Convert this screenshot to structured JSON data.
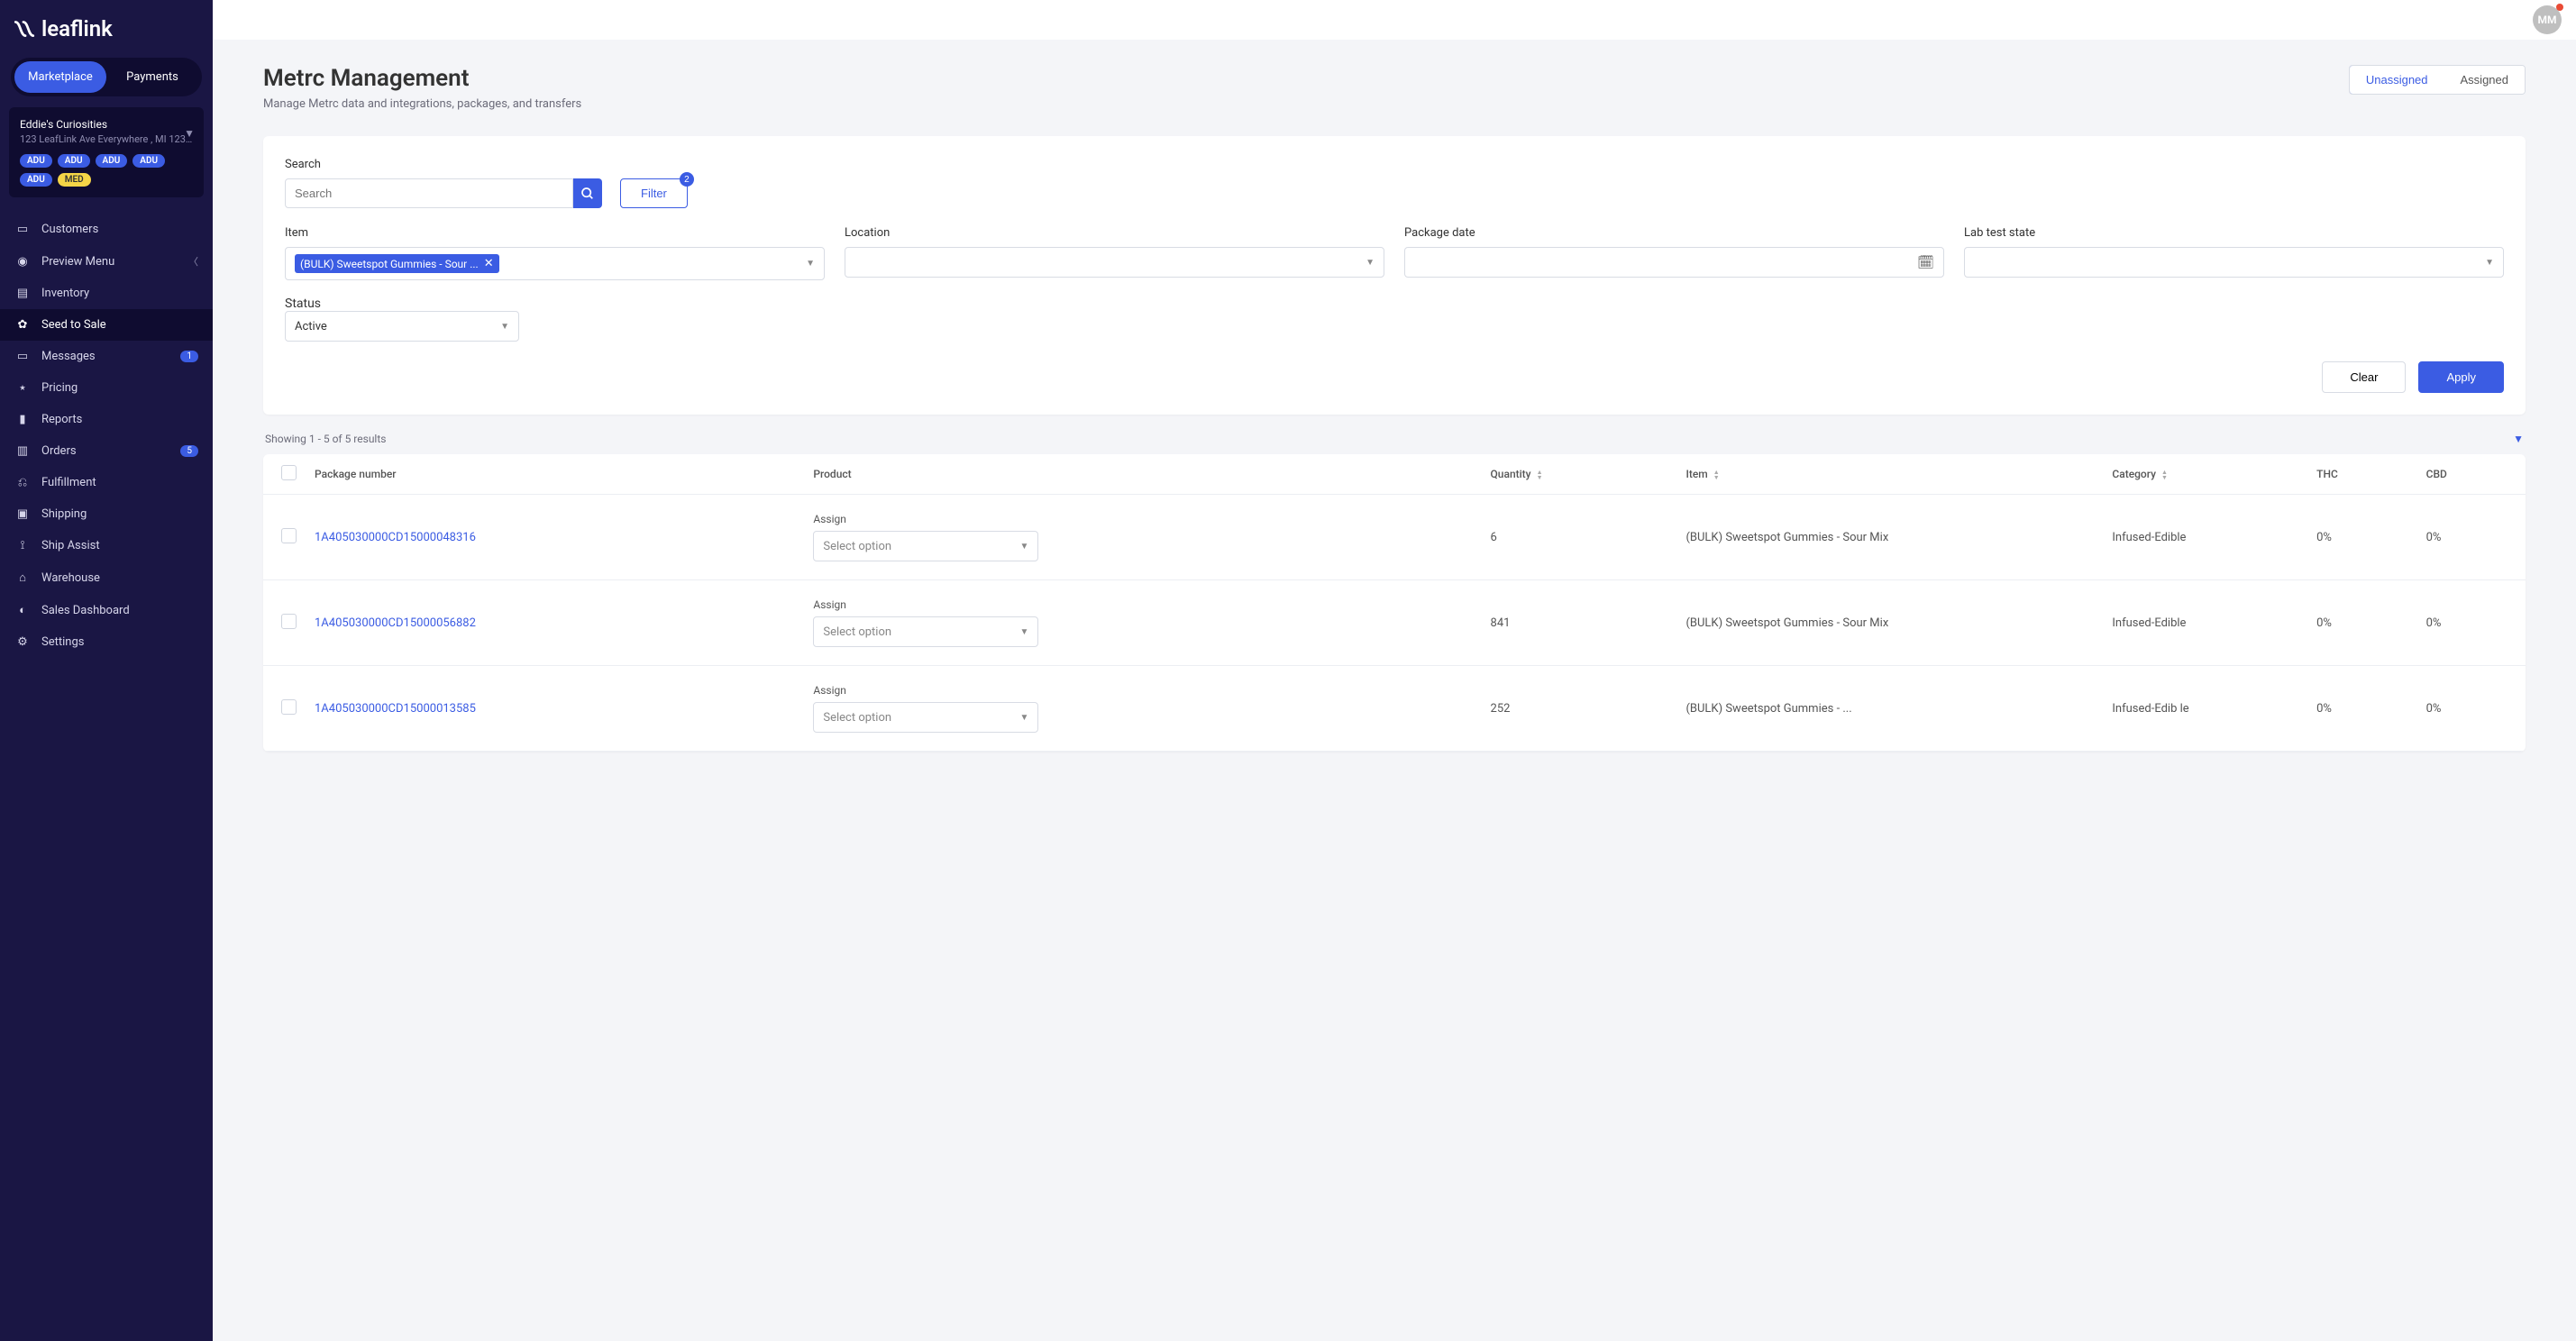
{
  "brand": "leaflink",
  "topTabs": {
    "marketplace": "Marketplace",
    "payments": "Payments"
  },
  "company": {
    "name": "Eddie's Curiosities",
    "address": "123 LeafLink Ave Everywhere , MI 123...",
    "badges": [
      "ADU",
      "ADU",
      "ADU",
      "ADU",
      "ADU",
      "MED"
    ]
  },
  "nav": [
    {
      "id": "customers",
      "label": "Customers"
    },
    {
      "id": "preview",
      "label": "Preview Menu",
      "chevron": true
    },
    {
      "id": "inventory",
      "label": "Inventory"
    },
    {
      "id": "seed-to-sale",
      "label": "Seed to Sale",
      "active": true
    },
    {
      "id": "messages",
      "label": "Messages",
      "count": "1"
    },
    {
      "id": "pricing",
      "label": "Pricing"
    },
    {
      "id": "reports",
      "label": "Reports"
    },
    {
      "id": "orders",
      "label": "Orders",
      "count": "5"
    },
    {
      "id": "fulfillment",
      "label": "Fulfillment"
    },
    {
      "id": "shipping",
      "label": "Shipping"
    },
    {
      "id": "ship-assist",
      "label": "Ship Assist"
    },
    {
      "id": "warehouse",
      "label": "Warehouse"
    },
    {
      "id": "sales-dashboard",
      "label": "Sales Dashboard"
    },
    {
      "id": "settings",
      "label": "Settings"
    }
  ],
  "avatar": "MM",
  "page": {
    "title": "Metrc Management",
    "subtitle": "Manage Metrc data and integrations, packages, and transfers",
    "tabs": {
      "unassigned": "Unassigned",
      "assigned": "Assigned"
    }
  },
  "filters": {
    "search_label": "Search",
    "search_placeholder": "Search",
    "filter_btn": "Filter",
    "filter_count": "2",
    "item_label": "Item",
    "item_chip": "(BULK) Sweetspot Gummies - Sour ...",
    "location_label": "Location",
    "package_date_label": "Package date",
    "lab_test_label": "Lab test state",
    "status_label": "Status",
    "status_value": "Active",
    "clear": "Clear",
    "apply": "Apply"
  },
  "results": {
    "meta": "Showing 1 - 5 of 5 results",
    "columns": {
      "package": "Package number",
      "product": "Product",
      "quantity": "Quantity",
      "item": "Item",
      "category": "Category",
      "thc": "THC",
      "cbd": "CBD"
    },
    "assign_label": "Assign",
    "assign_placeholder": "Select option",
    "rows": [
      {
        "pkg": "1A405030000CD15000048316",
        "qty": "6",
        "item": "(BULK) Sweetspot Gummies - Sour Mix",
        "cat": "Infused-Edible",
        "thc": "0%",
        "cbd": "0%"
      },
      {
        "pkg": "1A405030000CD15000056882",
        "qty": "841",
        "item": "(BULK) Sweetspot Gummies - Sour Mix",
        "cat": "Infused-Edible",
        "thc": "0%",
        "cbd": "0%"
      },
      {
        "pkg": "1A405030000CD15000013585",
        "qty": "252",
        "item": "(BULK) Sweetspot Gummies - ...",
        "cat": "Infused-Edib le",
        "thc": "0%",
        "cbd": "0%"
      }
    ]
  }
}
